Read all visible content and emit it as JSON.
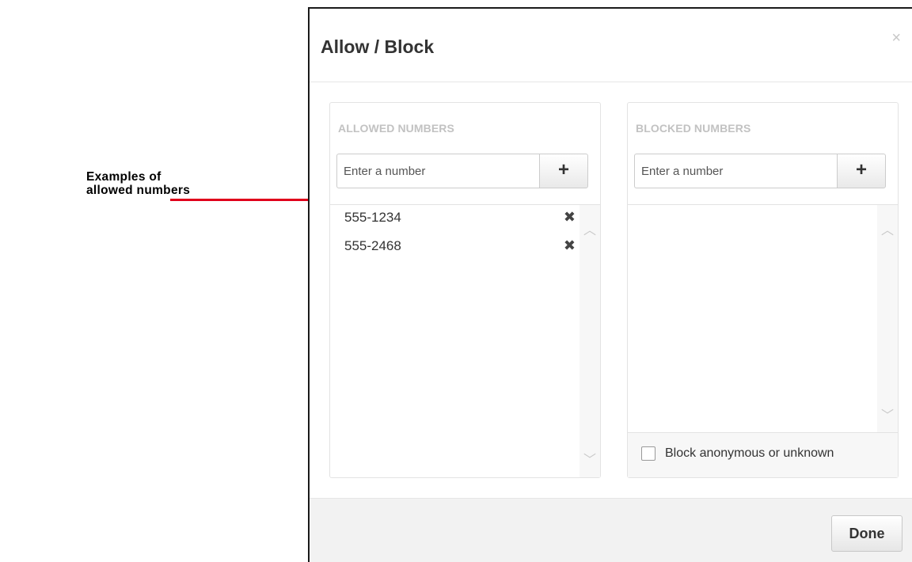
{
  "annotation": {
    "line1": "Examples of",
    "line2": "allowed numbers",
    "color": "#e0001b"
  },
  "modal": {
    "title": "Allow / Block",
    "close_icon": "×",
    "done_label": "Done"
  },
  "allowed": {
    "heading": "ALLOWED NUMBERS",
    "input_placeholder": "Enter a number",
    "add_icon": "+",
    "items": [
      {
        "number": "555-1234",
        "remove_icon": "✖"
      },
      {
        "number": "555-2468",
        "remove_icon": "✖"
      }
    ],
    "scroll_up_icon": "︿",
    "scroll_down_icon": "﹀"
  },
  "blocked": {
    "heading": "BLOCKED NUMBERS",
    "input_placeholder": "Enter a number",
    "add_icon": "+",
    "items": [],
    "scroll_up_icon": "︿",
    "scroll_down_icon": "﹀",
    "checkbox_label": "Block anonymous or unknown",
    "checkbox_checked": false
  }
}
